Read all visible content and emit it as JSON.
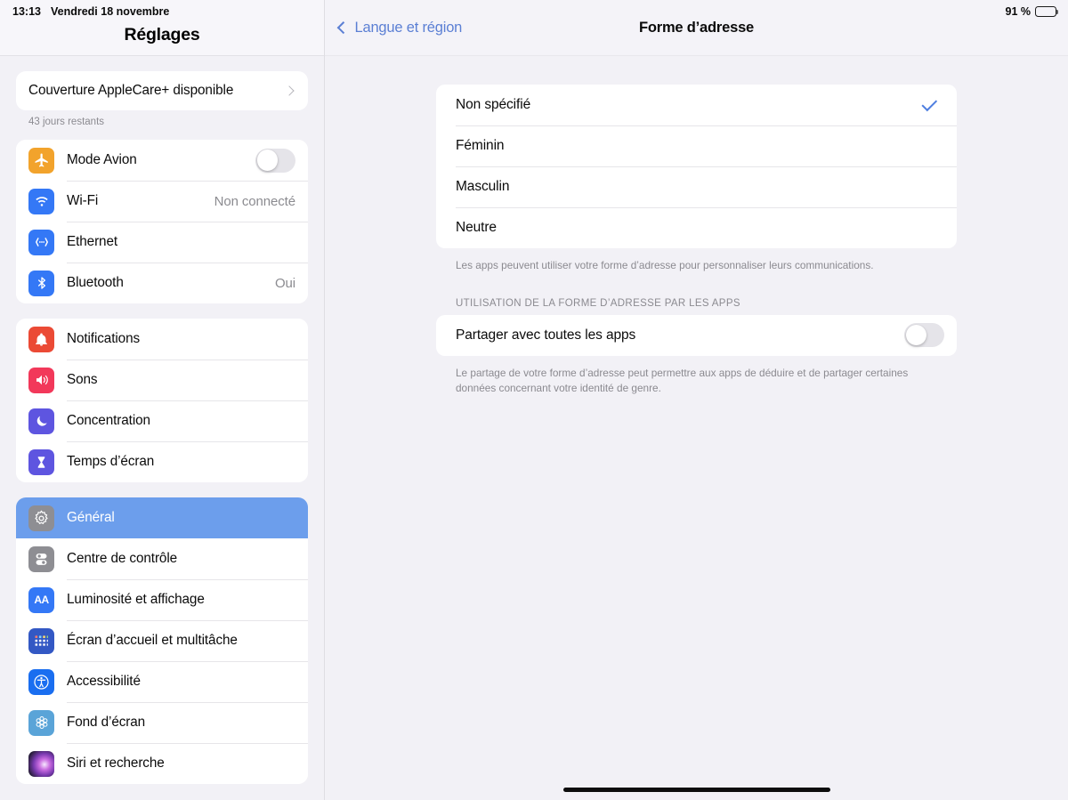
{
  "status_bar": {
    "time": "13:13",
    "date": "Vendredi 18 novembre",
    "battery_percent": "91 %",
    "battery_level": 91
  },
  "sidebar": {
    "title": "Réglages",
    "applecare": {
      "label": "Couverture AppleCare+ disponible",
      "footnote": "43 jours restants",
      "chevron": "chevron-right-icon"
    },
    "groups": [
      {
        "items": [
          {
            "label": "Mode Avion",
            "icon": "airplane-icon",
            "icon_color": "#f2a32c",
            "control": "switch",
            "switch_on": false
          },
          {
            "label": "Wi-Fi",
            "icon": "wifi-icon",
            "icon_color": "#3478f6",
            "value": "Non connecté"
          },
          {
            "label": "Ethernet",
            "icon": "ethernet-icon",
            "icon_color": "#3478f6"
          },
          {
            "label": "Bluetooth",
            "icon": "bluetooth-icon",
            "icon_color": "#3478f6",
            "value": "Oui"
          }
        ]
      },
      {
        "items": [
          {
            "label": "Notifications",
            "icon": "bell-icon",
            "icon_color": "#eb4a35"
          },
          {
            "label": "Sons",
            "icon": "speaker-icon",
            "icon_color": "#f2385a"
          },
          {
            "label": "Concentration",
            "icon": "moon-icon",
            "icon_color": "#5e55e0"
          },
          {
            "label": "Temps d’écran",
            "icon": "hourglass-icon",
            "icon_color": "#5e55e0"
          }
        ]
      },
      {
        "items": [
          {
            "label": "Général",
            "icon": "gear-icon",
            "icon_color": "#8e8e93",
            "selected": true
          },
          {
            "label": "Centre de contrôle",
            "icon": "control-center-icon",
            "icon_color": "#8e8e93"
          },
          {
            "label": "Luminosité et affichage",
            "icon": "aa-icon",
            "icon_color": "#3478f6"
          },
          {
            "label": "Écran d’accueil et multitâche",
            "icon": "app-grid-icon",
            "icon_color": "#3358c4"
          },
          {
            "label": "Accessibilité",
            "icon": "accessibility-icon",
            "icon_color": "#1a6ef0"
          },
          {
            "label": "Fond d’écran",
            "icon": "wallpaper-icon",
            "icon_color": "#5aa4d8"
          },
          {
            "label": "Siri et recherche",
            "icon": "siri-icon",
            "icon_color": "#2a1f3d"
          }
        ]
      }
    ]
  },
  "detail": {
    "back_label": "Langue et région",
    "back_icon": "chevron-left-icon",
    "title": "Forme d’adresse",
    "options": [
      {
        "label": "Non spécifié",
        "selected": true
      },
      {
        "label": "Féminin",
        "selected": false
      },
      {
        "label": "Masculin",
        "selected": false
      },
      {
        "label": "Neutre",
        "selected": false
      }
    ],
    "options_note": "Les apps peuvent utiliser votre forme d’adresse pour personnaliser leurs communications.",
    "section_header": "UTILISATION DE LA FORME D’ADRESSE PAR LES APPS",
    "share_row": {
      "label": "Partager avec toutes les apps",
      "switch_on": false
    },
    "share_note": "Le partage de votre forme d’adresse peut permettre aux apps de déduire et de partager certaines données concernant votre identité de genre."
  },
  "colors": {
    "accent_blue": "#3478f6",
    "selection_blue": "#6c9eec",
    "link_blue": "#5b7fd4",
    "checkmark_blue": "#4f7fe0",
    "page_bg": "#f2f1f6",
    "card_bg": "#ffffff"
  }
}
